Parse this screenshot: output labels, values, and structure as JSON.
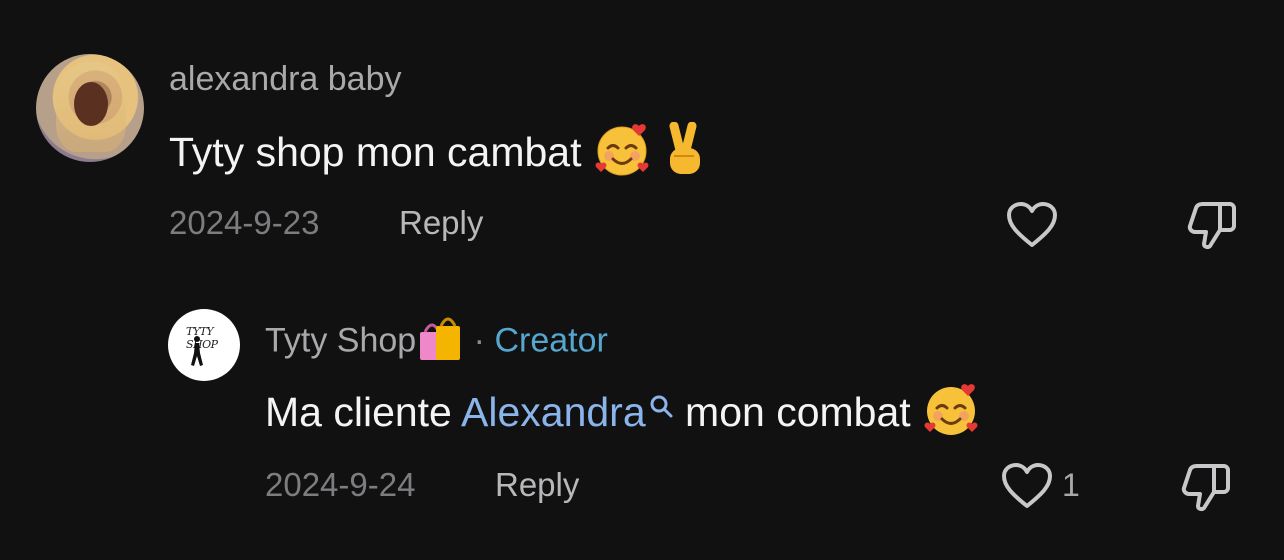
{
  "comments": [
    {
      "username": "alexandra baby",
      "text": "Tyty shop mon cambat",
      "date": "2024-9-23",
      "reply_label": "Reply",
      "likes": ""
    }
  ],
  "reply": {
    "username": "Tyty Shop",
    "separator": "·",
    "badge": "Creator",
    "text_before": "Ma cliente",
    "mention": "Alexandra",
    "text_after": "mon combat",
    "date": "2024-9-24",
    "reply_label": "Reply",
    "likes": "1",
    "avatar_logo": "TYTY SHOP"
  },
  "colors": {
    "background": "#111112",
    "mention": "#8ab4ea",
    "creator": "#56a6cf"
  },
  "icons": [
    "smiling-face-with-hearts-icon",
    "victory-hand-icon",
    "shopping-bags-icon",
    "search-icon",
    "heart-icon",
    "thumbs-down-icon"
  ]
}
